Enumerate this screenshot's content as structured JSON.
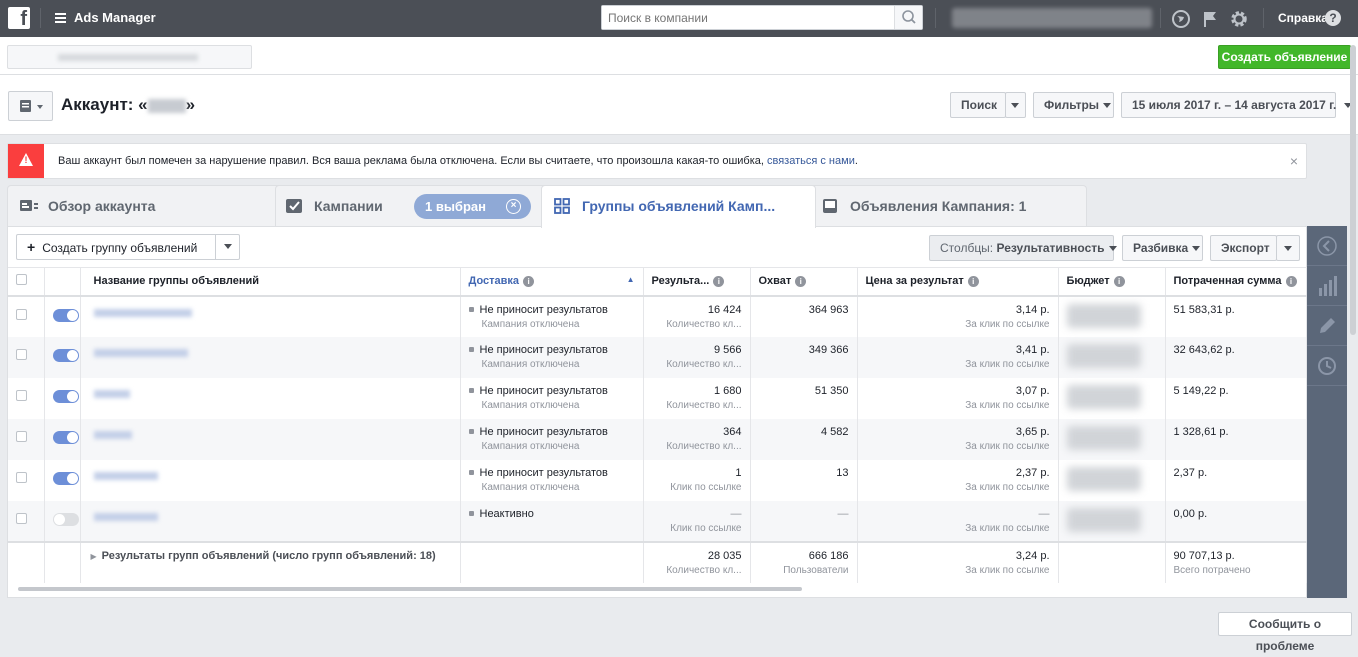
{
  "topbar": {
    "app_title": "Ads Manager",
    "search_placeholder": "Поиск в компании",
    "help_label": "Справка"
  },
  "subbar": {
    "create_ad_label": "Создать объявление"
  },
  "account": {
    "label_prefix": "Аккаунт: «",
    "label_suffix": "»",
    "search_btn": "Поиск",
    "filters_btn": "Фильтры",
    "date_range": "15 июля 2017 г. – 14 августа 2017 г."
  },
  "alert": {
    "icon": "warning-icon",
    "text": "Ваш аккаунт был помечен за нарушение правил. Вся ваша реклама была отключена. Если вы считаете, что произошла какая-то ошибка, ",
    "link": "связаться с нами",
    "text_end": "."
  },
  "tabs": [
    {
      "label": "Обзор аккаунта",
      "icon": "account-overview-icon"
    },
    {
      "label": "Кампании",
      "icon": "checkbox-icon"
    },
    {
      "label": "Группы объявлений Камп...",
      "icon": "grid-icon"
    },
    {
      "label": "Объявления Кампания: 1",
      "icon": "ad-icon"
    }
  ],
  "selected_pill": "1 выбран",
  "toolbar": {
    "create_adset": "Создать группу объявлений",
    "columns_prefix": "Столбцы: ",
    "columns_value": "Результативность",
    "breakdown": "Разбивка",
    "export": "Экспорт"
  },
  "columns": {
    "name": "Название группы объявлений",
    "delivery": "Доставка",
    "results": "Результа...",
    "reach": "Охват",
    "cost": "Цена за результат",
    "budget": "Бюджет",
    "spent": "Потраченная сумма"
  },
  "rows": [
    {
      "on": true,
      "delivery": "Не приносит результатов",
      "delivery_sub": "Кампания отключена",
      "results": "16 424",
      "results_sub": "Количество кл...",
      "reach": "364 963",
      "cost": "3,14 р.",
      "cost_sub": "За клик по ссылке",
      "spent": "51 583,31 р."
    },
    {
      "on": true,
      "delivery": "Не приносит результатов",
      "delivery_sub": "Кампания отключена",
      "results": "9 566",
      "results_sub": "Количество кл...",
      "reach": "349 366",
      "cost": "3,41 р.",
      "cost_sub": "За клик по ссылке",
      "spent": "32 643,62 р."
    },
    {
      "on": true,
      "delivery": "Не приносит результатов",
      "delivery_sub": "Кампания отключена",
      "results": "1 680",
      "results_sub": "Количество кл...",
      "reach": "51 350",
      "cost": "3,07 р.",
      "cost_sub": "За клик по ссылке",
      "spent": "5 149,22 р."
    },
    {
      "on": true,
      "delivery": "Не приносит результатов",
      "delivery_sub": "Кампания отключена",
      "results": "364",
      "results_sub": "Количество кл...",
      "reach": "4 582",
      "cost": "3,65 р.",
      "cost_sub": "За клик по ссылке",
      "spent": "1 328,61 р."
    },
    {
      "on": true,
      "delivery": "Не приносит результатов",
      "delivery_sub": "Кампания отключена",
      "results": "1",
      "results_sub": "Клик по ссылке",
      "reach": "13",
      "cost": "2,37 р.",
      "cost_sub": "За клик по ссылке",
      "spent": "2,37 р."
    },
    {
      "on": false,
      "delivery": "Неактивно",
      "delivery_sub": "",
      "results": "—",
      "results_sub": "Клик по ссылке",
      "reach": "—",
      "cost": "—",
      "cost_sub": "За клик по ссылке",
      "spent": "0,00 р."
    }
  ],
  "totals": {
    "label": "Результаты групп объявлений (число групп объявлений: 18)",
    "results": "28 035",
    "results_sub": "Количество кл...",
    "reach": "666 186",
    "reach_sub": "Пользователи",
    "cost": "3,24 р.",
    "cost_sub": "За клик по ссылке",
    "spent": "90 707,13 р.",
    "spent_sub": "Всего потрачено"
  },
  "report_problem": "Сообщить о проблеме"
}
